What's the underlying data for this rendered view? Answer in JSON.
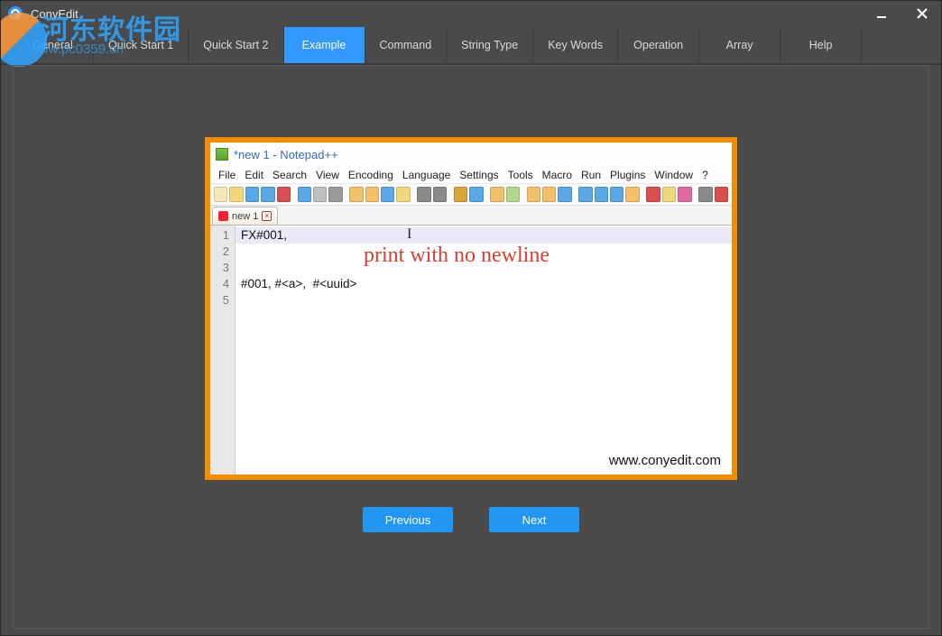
{
  "window": {
    "title": "ConyEdit"
  },
  "watermark": {
    "big": "河东软件园",
    "url": "www.pc0359.cn"
  },
  "tabs": [
    {
      "label": "General",
      "active": false
    },
    {
      "label": "Quick Start 1",
      "active": false
    },
    {
      "label": "Quick Start 2",
      "active": false
    },
    {
      "label": "Example",
      "active": true
    },
    {
      "label": "Command",
      "active": false
    },
    {
      "label": "String Type",
      "active": false
    },
    {
      "label": "Key Words",
      "active": false
    },
    {
      "label": "Operation",
      "active": false
    },
    {
      "label": "Array",
      "active": false
    },
    {
      "label": "Help",
      "active": false
    }
  ],
  "notepad": {
    "title": "*new 1 - Notepad++",
    "menus": [
      "File",
      "Edit",
      "Search",
      "View",
      "Encoding",
      "Language",
      "Settings",
      "Tools",
      "Macro",
      "Run",
      "Plugins",
      "Window",
      "?"
    ],
    "tab_name": "new 1",
    "lines": [
      "1",
      "2",
      "3",
      "4",
      "5"
    ],
    "code1": "FX#001,",
    "code4": "#001, #<a>,  #<uuid>",
    "annotation": "print with no newline",
    "site": "www.conyedit.com"
  },
  "nav": {
    "prev": "Previous",
    "next": "Next"
  },
  "toolbar_colors": [
    "#f5e7b8",
    "#f2d77a",
    "#5aa9e6",
    "#5aa9e6",
    "#d94f4f",
    "#5aa9e6",
    "#bfbfbf",
    "#9a9a9a",
    "#f2c069",
    "#f2c069",
    "#5aa9e6",
    "#f2d77a",
    "#8a8a8a",
    "#8a8a8a",
    "#d8a53a",
    "#5aa9e6",
    "#f2c069",
    "#b1d88a",
    "#f2c069",
    "#f2c069",
    "#5aa9e6",
    "#5aa9e6",
    "#5aa9e6",
    "#5aa9e6",
    "#f2c069",
    "#d94f4f",
    "#f2d77a",
    "#e26aa2",
    "#8a8a8a",
    "#d94f4f"
  ]
}
